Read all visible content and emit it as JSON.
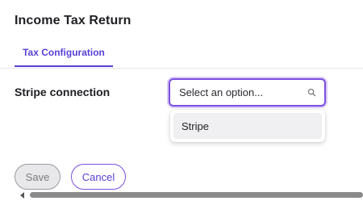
{
  "header": {
    "title": "Income Tax Return"
  },
  "tabs": [
    {
      "label": "Tax Configuration",
      "active": true
    }
  ],
  "form": {
    "stripe_connection": {
      "label": "Stripe connection",
      "placeholder": "Select an option...",
      "icon": "search-icon",
      "options": [
        {
          "label": "Stripe"
        }
      ]
    }
  },
  "actions": {
    "save_label": "Save",
    "cancel_label": "Cancel"
  },
  "colors": {
    "accent": "#5a3fd6",
    "focus_border": "#7b4fe0"
  }
}
